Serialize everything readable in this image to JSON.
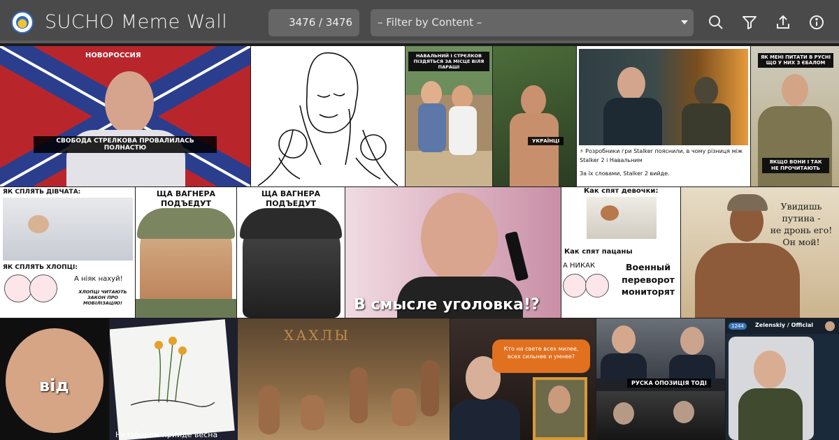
{
  "app": {
    "title": "SUCHO Meme Wall",
    "counter": "3476 / 3476",
    "filter_placeholder": "– Filter by Content –"
  },
  "toolbar_icons": [
    "search-icon",
    "filter-icon",
    "upload-icon",
    "info-icon"
  ],
  "colors": {
    "toolbar_bg": "#4a4a4a",
    "control_bg": "#666666",
    "text": "#f2f2f2"
  },
  "memes": {
    "strelkov": {
      "caption": "СВОБОДА СТРЕЛКОВА ПРОВАЛИЛАСЬ ПОЛНАСТЮ",
      "flag_text": "НОВОРОССИЯ"
    },
    "navalny_strelkov_girls": {
      "top": "НАВАЛЬНИЙ І СТРЄЛКОВ\nПІЗДЯТЬСЯ ЗА МІСЦЕ ВІЛЯ ПАРАШІ",
      "bottom": "УКРАЇНЦІ"
    },
    "stalker": {
      "line1": "⚡ Розробники гри Stalker пояснили, в чому різниця між",
      "line2": "Stalker 2 і Навальним",
      "line3": "За їх словами, Stalker 2 вийде."
    },
    "budanov": {
      "top": "ЯК МЕНІ ПИТАТИ В РУСНІ\nЩО У НИХ З ЄБАЛОМ",
      "bottom": "ЯКЩО ВОНИ І ТАК\nНЕ ПРОЧИТАЮТЬ"
    },
    "girls_sleep": {
      "top": "ЯК СПЛЯТЬ ДІВЧАТА:",
      "mid": "ЯК СПЛЯТЬ ХЛОПЦІ:",
      "speech": "А ніяк нахуй!",
      "note": "ХЛОПЦІ ЧИТАЮТЬ\nЗАКОН ПРО\nМОБІЛІЗАЦІЮ!"
    },
    "wagner": {
      "caption": "ЩА ВАГНЕРА\nПОДЪЕДУТ"
    },
    "prigozhin": {
      "caption": "В смысле уголовка!?"
    },
    "devochki": {
      "top": "Как спят девочки:",
      "mid": "Как спят пацаны",
      "nikak": "А НИКАК",
      "coup": "Военный\nпереворот\nмониторят"
    },
    "pirate": {
      "caption": "Увидишь\nпутина -\nне дронь его!\nОн мой!"
    },
    "fist": {
      "caption": "від"
    },
    "sunflowers": {
      "caption": "Незабаром прийде весна"
    },
    "cavemen": {
      "caption": "ХАХЛЫ"
    },
    "putin": {
      "bubble": "Кто на свете всех милее,\nвсех сильнее и умнее?"
    },
    "opposition": {
      "caption": "РУСКА ОПОЗИЦІЯ ТОДІ"
    },
    "zelensky": {
      "channel": "Zelenskiy / Official",
      "badge": "1244"
    }
  }
}
